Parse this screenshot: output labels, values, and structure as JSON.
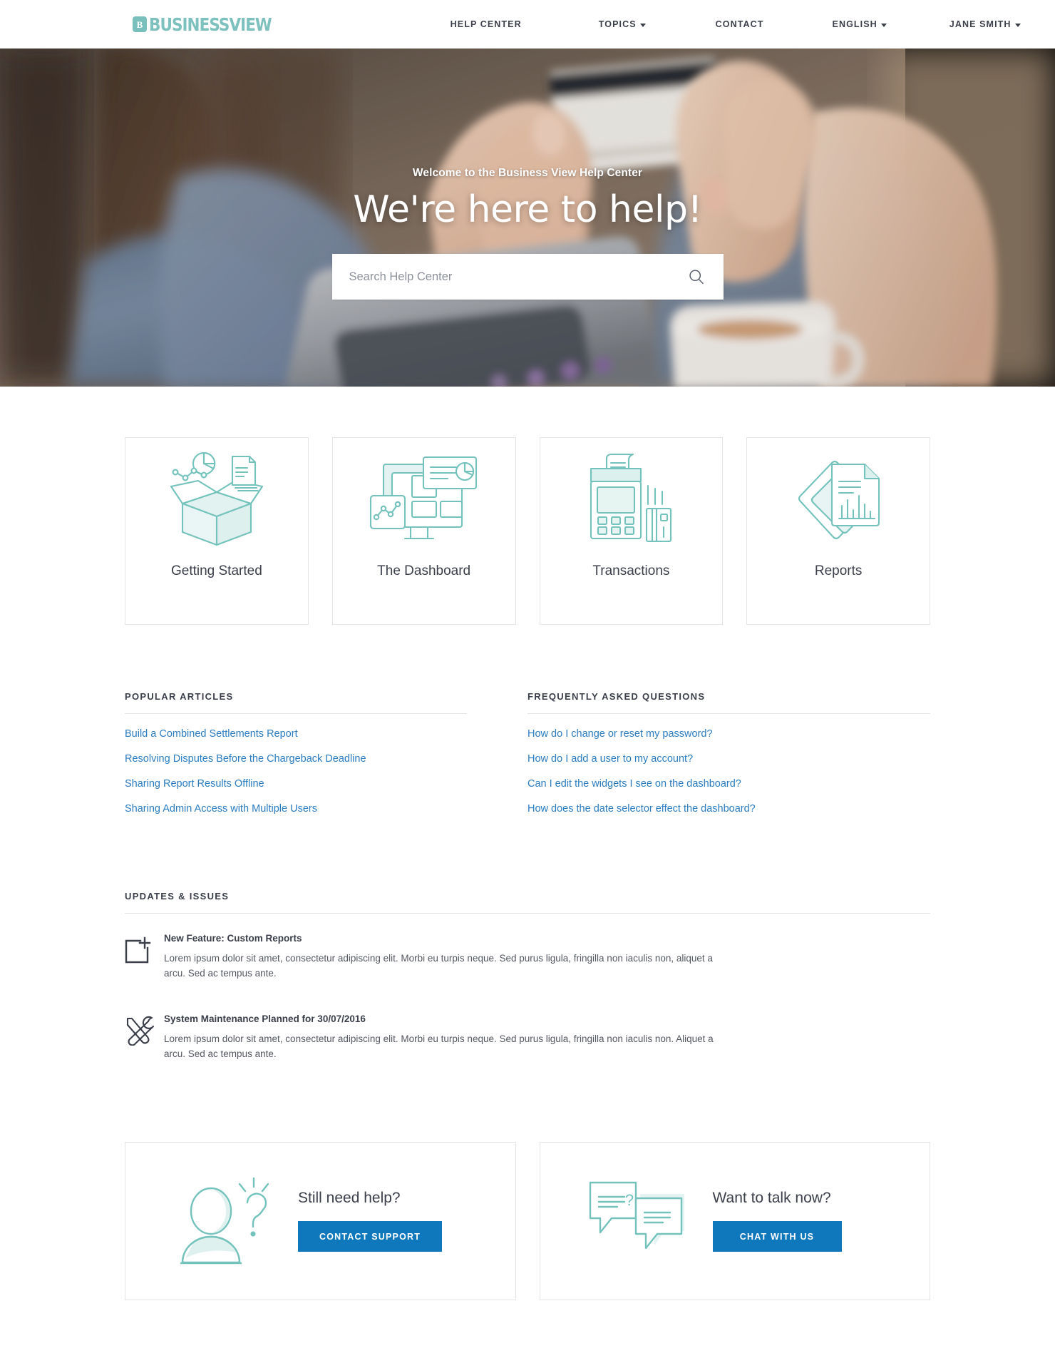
{
  "header": {
    "logo": {
      "mark": "B",
      "text": "BUSINESSVIEW",
      "color": "#7cc1bd"
    },
    "nav": [
      {
        "label": "HELP CENTER",
        "caret": false
      },
      {
        "label": "TOPICS",
        "caret": true
      },
      {
        "label": "CONTACT",
        "caret": false
      },
      {
        "label": "ENGLISH",
        "caret": true
      },
      {
        "label": "JANE SMITH",
        "caret": true
      }
    ]
  },
  "hero": {
    "eyebrow": "Welcome to the Business View Help Center",
    "title": "We're here to help!",
    "search": {
      "placeholder": "Search Help Center",
      "value": "",
      "icon": "search-icon"
    }
  },
  "categories": [
    {
      "label": "Getting Started",
      "icon": "open-box-icon"
    },
    {
      "label": "The Dashboard",
      "icon": "dashboard-screens-icon"
    },
    {
      "label": "Transactions",
      "icon": "card-terminal-icon"
    },
    {
      "label": "Reports",
      "icon": "documents-chart-icon"
    }
  ],
  "popular_articles": {
    "title": "POPULAR ARTICLES",
    "items": [
      "Build a Combined Settlements Report",
      "Resolving Disputes Before the Chargeback Deadline",
      "Sharing Report Results Offline",
      "Sharing Admin Access with Multiple Users"
    ]
  },
  "faq": {
    "title": "FREQUENTLY ASKED QUESTIONS",
    "items": [
      "How do I change or reset my password?",
      "How do I add a user to my account?",
      "Can I edit the widgets I see on the dashboard?",
      "How does the date selector effect the dashboard?"
    ]
  },
  "updates": {
    "title": "UPDATES & ISSUES",
    "items": [
      {
        "icon": "new-item-plus-icon",
        "title": "New Feature: Custom Reports",
        "text": "Lorem ipsum dolor sit amet, consectetur adipiscing elit. Morbi eu turpis neque. Sed purus ligula, fringilla non iaculis non, aliquet a arcu. Sed ac tempus ante."
      },
      {
        "icon": "wrench-screwdriver-icon",
        "title": "System Maintenance Planned for 30/07/2016",
        "text": "Lorem ipsum dolor sit amet, consectetur adipiscing elit. Morbi eu turpis neque. Sed purus ligula, fringilla non iaculis non. Aliquet a arcu. Sed ac tempus ante."
      }
    ]
  },
  "ctas": [
    {
      "icon": "person-question-icon",
      "title": "Still need help?",
      "button": "CONTACT SUPPORT"
    },
    {
      "icon": "chat-bubbles-icon",
      "title": "Want to talk now?",
      "button": "CHAT WITH US"
    }
  ],
  "colors": {
    "teal": "#74c2bc",
    "blue": "#0f78bd",
    "link": "#2b7cc0",
    "text": "#3b3f4a"
  }
}
